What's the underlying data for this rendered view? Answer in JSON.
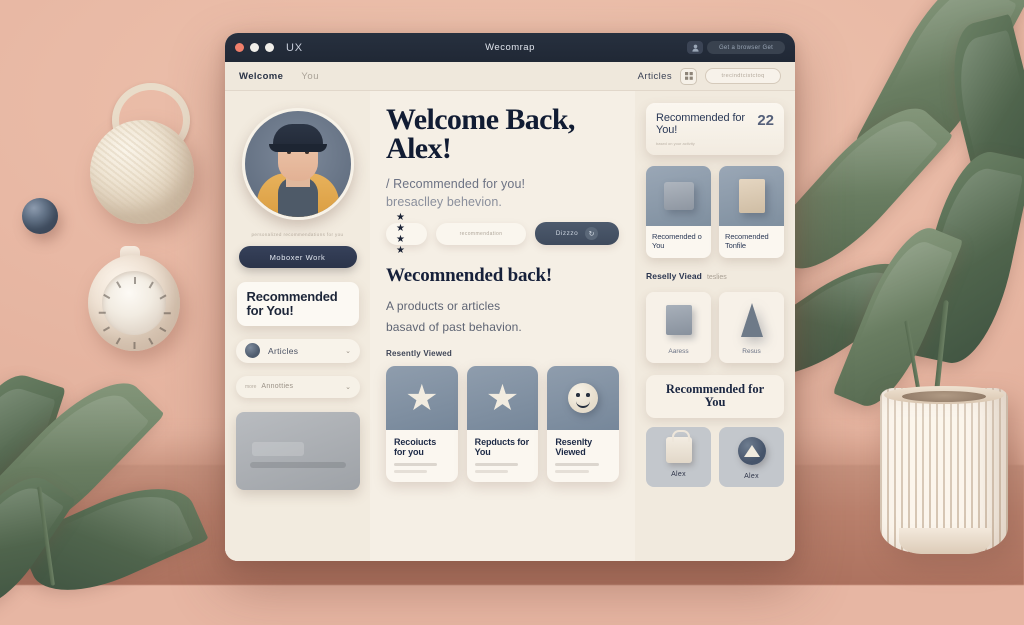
{
  "window": {
    "app_name": "UX",
    "title": "Wecomrap",
    "dots": [
      "close",
      "minimize",
      "maximize"
    ],
    "right_icon": "profile-icon",
    "right_pill": "Get a browser Get"
  },
  "toolbar": {
    "left_items": [
      {
        "label": "Welcome",
        "active": true
      },
      {
        "label": "You",
        "active": false
      }
    ],
    "right_label": "Articles",
    "right_icon": "grid-icon",
    "right_pill": "trecindtcistctoq"
  },
  "sidebar_left": {
    "avatar_name": "user-avatar",
    "caption": "personalized recommendations for you",
    "primary_button": "Moboxer Work",
    "promo_card": "Recommended for You!",
    "rows": [
      {
        "label": "Articles",
        "icon": "circle-avatar",
        "chevron": "chevron-down-icon"
      },
      {
        "label": "Annotties",
        "prefix": "more",
        "chevron": "chevron-down-icon"
      }
    ],
    "preview_box": "media-preview"
  },
  "main": {
    "hero_title": "Welcome Back, Alex!",
    "hero_sub_line1": "/ Recommended for you!",
    "hero_sub_line2": "bresaclley behevion.",
    "rating_stars": "★ ★ ★ ★",
    "chip_secondary": "recommendation",
    "cta_label": "Dizzzo",
    "cta_icon": "refresh-icon",
    "section_title": "Wecomnended back!",
    "section_sub_line1": "A products or articles",
    "section_sub_line2": "basavd of past behavion.",
    "subsection_title": "Resently Viewed",
    "cards": [
      {
        "title": "Recoiucts for you",
        "icon": "star-icon"
      },
      {
        "title": "Repducts for You",
        "icon": "star-icon"
      },
      {
        "title": "Resenlty Viewed",
        "icon": "smiley-icon"
      }
    ]
  },
  "sidebar_right": {
    "header_title": "Recommended for You!",
    "header_count": "22",
    "header_sub": "based on your activity",
    "top_cards": [
      {
        "title": "Recomended o You",
        "icon": "square-icon"
      },
      {
        "title": "Recomended Tonfile",
        "icon": "bag-icon"
      }
    ],
    "recent_title": "Reselly Viead",
    "recent_title_sub": "teslies",
    "recent_cards": [
      {
        "label": "Aaress",
        "icon": "box-icon"
      },
      {
        "label": "Resus",
        "icon": "cone-icon"
      }
    ],
    "promo_title": "Recommended for You",
    "bottom_cards": [
      {
        "label": "Alex",
        "icon": "shopping-bag-icon"
      },
      {
        "label": "Alex",
        "icon": "badge-icon"
      }
    ]
  },
  "colors": {
    "background": "#e8b8a4",
    "window_bg": "#f4eee4",
    "titlebar": "#27303f",
    "accent_dark": "#2b344a",
    "text_dark": "#16203a"
  }
}
